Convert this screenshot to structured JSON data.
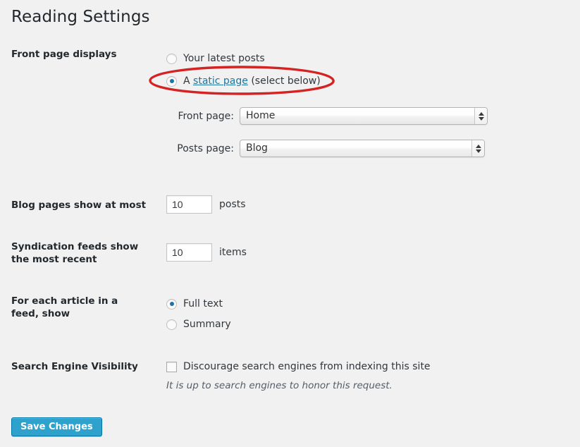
{
  "page": {
    "title": "Reading Settings",
    "background_color": "#f1f1f1",
    "link_color": "#21759b",
    "accent_color": "#2ea2cc",
    "annotation_color": "#d42323"
  },
  "sections": {
    "front_page_displays": {
      "label": "Front page displays",
      "options": [
        {
          "label": "Your latest posts",
          "selected": false
        },
        {
          "label_prefix": "A ",
          "link_text": "static page",
          "label_suffix": " (select below)",
          "selected": true
        }
      ],
      "selects": [
        {
          "caption": "Front page:",
          "value": "Home"
        },
        {
          "caption": "Posts page:",
          "value": "Blog"
        }
      ]
    },
    "blog_pages": {
      "label": "Blog pages show at most",
      "value": "10",
      "unit": "posts"
    },
    "syndication_feeds": {
      "label": "Syndication feeds show the most recent",
      "value": "10",
      "unit": "items"
    },
    "feed_article": {
      "label": "For each article in a feed, show",
      "options": [
        {
          "label": "Full text",
          "selected": true
        },
        {
          "label": "Summary",
          "selected": false
        }
      ]
    },
    "search_engine_visibility": {
      "label": "Search Engine Visibility",
      "checkbox_label": "Discourage search engines from indexing this site",
      "checked": false,
      "help_text": "It is up to search engines to honor this request."
    }
  },
  "footer": {
    "save_label": "Save Changes"
  },
  "icons": {
    "stepper": "stepper-arrows-icon",
    "annotation": "red-ellipse-annotation-icon"
  }
}
